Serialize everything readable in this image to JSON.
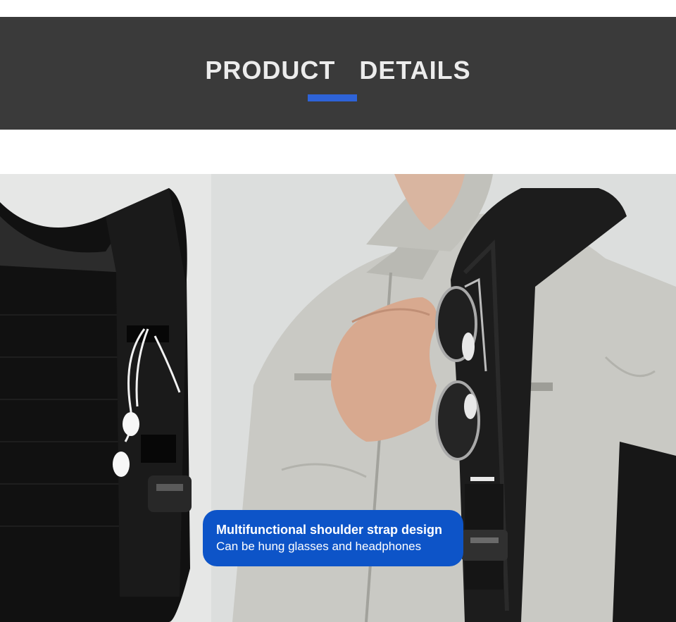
{
  "header": {
    "title_word_1": "PRODUCT",
    "title_word_2": "DETAILS",
    "band_color": "#3a3a3a",
    "accent_color": "#2e63d8"
  },
  "photo": {
    "subject": "backpack-shoulder-strap-with-sunglasses-and-earphones"
  },
  "caption": {
    "title": "Multifunctional shoulder strap design",
    "subtitle": "Can be hung glasses and headphones",
    "background_color": "#0d54c8"
  }
}
